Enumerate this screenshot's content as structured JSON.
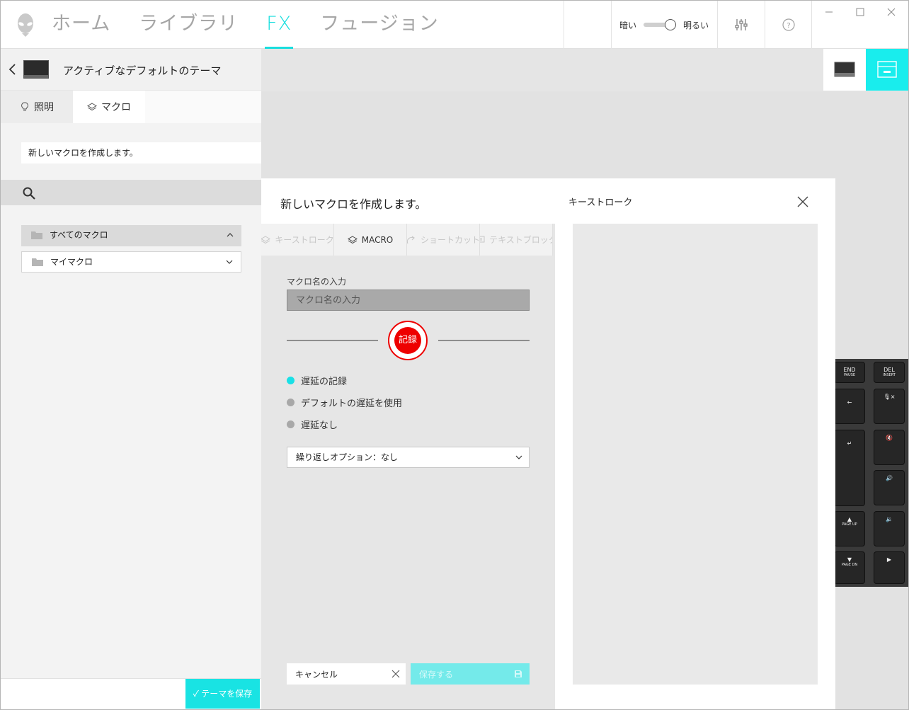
{
  "nav": {
    "items": [
      "ホーム",
      "ライブラリ",
      "FX",
      "フュージョン"
    ],
    "active": "FX"
  },
  "theme_toggle": {
    "dark": "暗い",
    "light": "明るい"
  },
  "left_panel": {
    "title": "アクティブなデフォルトのテーマ",
    "tabs": {
      "lighting": "照明",
      "macro": "マクロ"
    },
    "description": "新しいマクロを作成します。",
    "folders": {
      "all": "すべてのマクロ",
      "mine": "マイマクロ"
    },
    "save_theme": "✓ テーマを保存"
  },
  "modal": {
    "title": "新しいマクロを作成します。",
    "tabs": {
      "keystroke": "キーストローク",
      "macro": "MACRO",
      "shortcut": "ショートカット",
      "textblock": "テキストブロック"
    },
    "name_label": "マクロ名の入力",
    "name_placeholder": "マクロ名の入力",
    "record": "記録",
    "delay_options": [
      "遅延の記録",
      "デフォルトの遅延を使用",
      "遅延なし"
    ],
    "repeat": "繰り返しオプション：なし",
    "cancel": "キャンセル",
    "save": "保存する",
    "keystroke_title": "キーストローク"
  },
  "keyboard_keys": [
    {
      "main": "END",
      "sub": "PAUSE"
    },
    {
      "main": "DEL",
      "sub": "INSERT"
    },
    {
      "main": "←",
      "sub": ""
    },
    {
      "main": "🎙×",
      "sub": ""
    },
    {
      "main": "↵",
      "sub": ""
    },
    {
      "main": "🔇",
      "sub": ""
    },
    {
      "main": "🔊",
      "sub": ""
    },
    {
      "main": "▲",
      "sub": "PAGE UP"
    },
    {
      "main": "🔉",
      "sub": ""
    },
    {
      "main": "▼",
      "sub": "PAGE DN"
    },
    {
      "main": "▶",
      "sub": ""
    }
  ],
  "colors": {
    "accent": "#19dede",
    "record": "#ee0000"
  }
}
